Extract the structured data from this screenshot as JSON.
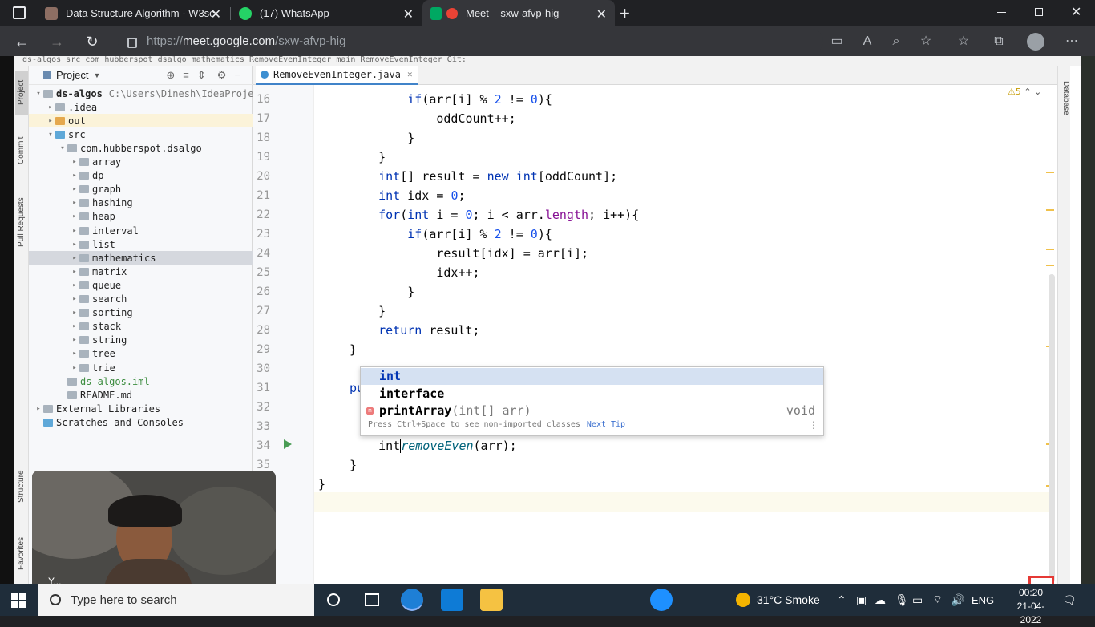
{
  "browser": {
    "tabs": [
      {
        "title": "Data Structure Algorithm - W3sc",
        "color": "#8d6e63"
      },
      {
        "title": "(17) WhatsApp",
        "color": "#25d366"
      },
      {
        "title": "Meet – sxw-afvp-hig",
        "color": "#ea4335",
        "active": true
      }
    ],
    "url_scheme": "https://",
    "url_host": "meet.google.com",
    "url_path": "/sxw-afvp-hig"
  },
  "ide": {
    "breadcrumb": "ds-algos  src  com  hubberspot  dsalgo  mathematics  RemoveEvenInteger  main        RemoveEvenInteger    Git:",
    "left_stripe": [
      "Project",
      "Commit",
      "Pull Requests",
      "Structure",
      "Favorites"
    ],
    "right_stripe": "Database",
    "project_header": "Project",
    "tree": [
      {
        "label": "ds-algos",
        "path": "C:\\Users\\Dinesh\\IdeaProjec",
        "indent": 0,
        "arrow": "▾",
        "icon": "fold-gray",
        "bold": true
      },
      {
        "label": ".idea",
        "indent": 1,
        "arrow": "▸",
        "icon": "fold-gray"
      },
      {
        "label": "out",
        "indent": 1,
        "arrow": "▸",
        "icon": "fold-orange",
        "hl": true
      },
      {
        "label": "src",
        "indent": 1,
        "arrow": "▾",
        "icon": "fold-blue"
      },
      {
        "label": "com.hubberspot.dsalgo",
        "indent": 2,
        "arrow": "▾",
        "icon": "fold-gray"
      },
      {
        "label": "array",
        "indent": 3,
        "arrow": "▸",
        "icon": "fold-gray"
      },
      {
        "label": "dp",
        "indent": 3,
        "arrow": "▸",
        "icon": "fold-gray"
      },
      {
        "label": "graph",
        "indent": 3,
        "arrow": "▸",
        "icon": "fold-gray"
      },
      {
        "label": "hashing",
        "indent": 3,
        "arrow": "▸",
        "icon": "fold-gray"
      },
      {
        "label": "heap",
        "indent": 3,
        "arrow": "▸",
        "icon": "fold-gray"
      },
      {
        "label": "interval",
        "indent": 3,
        "arrow": "▸",
        "icon": "fold-gray"
      },
      {
        "label": "list",
        "indent": 3,
        "arrow": "▸",
        "icon": "fold-gray"
      },
      {
        "label": "mathematics",
        "indent": 3,
        "arrow": "▸",
        "icon": "fold-gray",
        "sel": true
      },
      {
        "label": "matrix",
        "indent": 3,
        "arrow": "▸",
        "icon": "fold-gray"
      },
      {
        "label": "queue",
        "indent": 3,
        "arrow": "▸",
        "icon": "fold-gray"
      },
      {
        "label": "search",
        "indent": 3,
        "arrow": "▸",
        "icon": "fold-gray"
      },
      {
        "label": "sorting",
        "indent": 3,
        "arrow": "▸",
        "icon": "fold-gray"
      },
      {
        "label": "stack",
        "indent": 3,
        "arrow": "▸",
        "icon": "fold-gray"
      },
      {
        "label": "string",
        "indent": 3,
        "arrow": "▸",
        "icon": "fold-gray"
      },
      {
        "label": "tree",
        "indent": 3,
        "arrow": "▸",
        "icon": "fold-gray"
      },
      {
        "label": "trie",
        "indent": 3,
        "arrow": "▸",
        "icon": "fold-gray"
      },
      {
        "label": "ds-algos.iml",
        "indent": 2,
        "arrow": "",
        "icon": "fold-gray",
        "green": true
      },
      {
        "label": "README.md",
        "indent": 2,
        "arrow": "",
        "icon": "fold-gray"
      },
      {
        "label": "External Libraries",
        "indent": 0,
        "arrow": "▸",
        "icon": "fold-gray"
      },
      {
        "label": "Scratches and Consoles",
        "indent": 0,
        "arrow": "",
        "icon": "fold-blue"
      }
    ],
    "file_tab": "RemoveEvenInteger.java",
    "warnings": "⚠5",
    "code_lines": [
      {
        "n": "16",
        "html": "        <span class='kw'>if</span>(arr[i] % <span class='num'>2</span> != <span class='num'>0</span>){"
      },
      {
        "n": "17",
        "html": "            oddCount++;"
      },
      {
        "n": "18",
        "html": "        }"
      },
      {
        "n": "19",
        "html": "    }"
      },
      {
        "n": "20",
        "html": "    <span class='kw'>int</span>[] result = <span class='kw'>new int</span>[oddCount];"
      },
      {
        "n": "21",
        "html": "    <span class='kw'>int</span> idx = <span class='num'>0</span>;"
      },
      {
        "n": "22",
        "html": "    <span class='kw'>for</span>(<span class='kw'>int</span> i = <span class='num'>0</span>; i &lt; arr.<span class='fld'>length</span>; i++){"
      },
      {
        "n": "23",
        "html": "        <span class='kw'>if</span>(arr[i] % <span class='num'>2</span> != <span class='num'>0</span>){"
      },
      {
        "n": "24",
        "html": "            result[idx] = arr[i];"
      },
      {
        "n": "25",
        "html": "            idx++;"
      },
      {
        "n": "26",
        "html": "        }"
      },
      {
        "n": "27",
        "html": "    }"
      },
      {
        "n": "28",
        "html": "    <span class='kw'>return</span> result;"
      },
      {
        "n": "29",
        "html": "}"
      },
      {
        "n": "30",
        "html": ""
      },
      {
        "n": "31",
        "html": "<span class='kw'>pu</span>"
      },
      {
        "n": "32",
        "html": ""
      },
      {
        "n": "33",
        "html": ""
      },
      {
        "n": "34",
        "html": "    int<span style='border-left:1.5px solid #000'></span><span class='fn'>removeEven</span>(arr);"
      },
      {
        "n": "35",
        "html": "}"
      },
      {
        "n": "",
        "html": "}"
      }
    ],
    "completion": {
      "items": [
        {
          "prefix": "",
          "match": "int",
          "rest": "",
          "sig": "",
          "ret": "",
          "selected": true
        },
        {
          "prefix": "",
          "match": "int",
          "rest": "erface",
          "sig": "",
          "ret": ""
        },
        {
          "prefix": "pr",
          "match": "int",
          "rest": "Array",
          "sig": "(int[] arr)",
          "ret": "void",
          "method": true
        }
      ],
      "tip": "Press Ctrl+Space to see non-imported classes",
      "tip_link": "Next Tip"
    }
  },
  "webcam_label": "Y...",
  "taskbar": {
    "search_placeholder": "Type here to search",
    "weather": "31°C  Smoke",
    "lang": "ENG",
    "time": "00:20",
    "date": "21-04-2022"
  }
}
